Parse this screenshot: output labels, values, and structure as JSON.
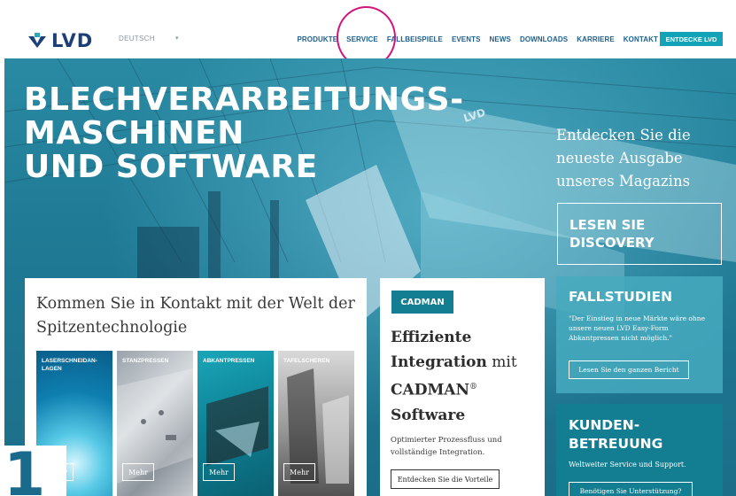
{
  "header": {
    "logo_text": "LVD",
    "language": "DEUTSCH",
    "language_caret": "▾",
    "nav_items": [
      "PRODUKTE",
      "SERVICE",
      "FALLBEISPIELE",
      "EVENTS",
      "NEWS",
      "DOWNLOADS",
      "KARRIERE",
      "KONTAKT"
    ],
    "cta": "ENTDECKE LVD",
    "brand_color": "#1c3f78",
    "accent_color": "#13a4b8",
    "highlight_circle_color": "#d1157d"
  },
  "hero": {
    "title_lines": [
      "BLECHVERARBEITUNGS-",
      "MASCHINEN",
      "UND SOFTWARE"
    ],
    "magazine_text": "Entdecken Sie die neueste Ausgabe unseres Magazins",
    "magazine_button_lines": [
      "LESEN SIE",
      "DISCOVERY"
    ]
  },
  "contact": {
    "title": "Kommen Sie in Kontakt mit der Welt der Spitzentechnologie",
    "tiles": [
      {
        "label": "LASERSCHNEIDAN-LAGEN",
        "more": "Mehr"
      },
      {
        "label": "STANZPRESSEN",
        "more": "Mehr"
      },
      {
        "label": "ABKANTPRESSEN",
        "more": "Mehr"
      },
      {
        "label": "TAFELSCHEREN",
        "more": "Mehr"
      }
    ]
  },
  "cadman": {
    "badge": "CADMAN",
    "heading_bold_1": "Effiziente",
    "heading_bold_2": "Integration",
    "heading_normal": " mit",
    "heading_bold_3": "CADMAN",
    "heading_reg": "®",
    "heading_bold_4": "Software",
    "description": "Optimierter Prozessfluss und vollständige Integration.",
    "button": "Entdecken Sie die Vorteile"
  },
  "fallstudien": {
    "title": "FALLSTUDIEN",
    "quote": "\"Der Einstieg in neue Märkte wäre ohne unsere neuen LVD Easy-Form Abkantpressen nicht möglich.\"",
    "button": "Lesen Sie den ganzen Bericht"
  },
  "kunden": {
    "title_lines": [
      "KUNDEN-",
      "BETREUUNG"
    ],
    "description": "Weltweiter Service und Support.",
    "button": "Benötigen Sie Unterstützung?"
  },
  "overlay": {
    "page_number": "1"
  }
}
